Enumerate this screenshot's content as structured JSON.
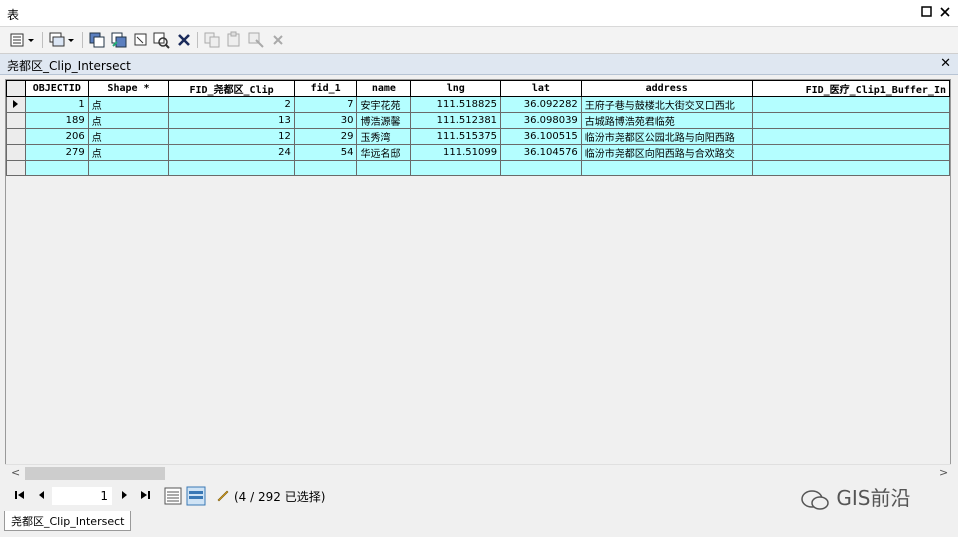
{
  "window": {
    "title": "表"
  },
  "tab": {
    "title": "尧都区_Clip_Intersect"
  },
  "table": {
    "columns": [
      "OBJECTID",
      "Shape *",
      "FID_尧都区_Clip",
      "fid_1",
      "name",
      "lng",
      "lat",
      "address",
      "FID_医疗_Clip1_Buffer_In"
    ],
    "rows": [
      [
        "1",
        "点",
        "2",
        "7",
        "安宇花苑",
        "111.518825",
        "36.092282",
        "王府子巷与鼓楼北大街交叉口西北",
        ""
      ],
      [
        "189",
        "点",
        "13",
        "30",
        "博浩源馨",
        "111.512381",
        "36.098039",
        "古城路博浩苑君临苑",
        ""
      ],
      [
        "206",
        "点",
        "12",
        "29",
        "玉秀湾",
        "111.515375",
        "36.100515",
        "临汾市尧都区公园北路与向阳西路",
        ""
      ],
      [
        "279",
        "点",
        "24",
        "54",
        "华远名邸",
        "111.51099",
        "36.104576",
        "临汾市尧都区向阳西路与合欢路交",
        ""
      ]
    ]
  },
  "status": {
    "page": "1",
    "selection": "(4 / 292 已选择)"
  },
  "bottom_tab": {
    "label": "尧都区_Clip_Intersect"
  },
  "watermark": {
    "text": "GIS前沿"
  },
  "colors": {
    "row_bg": "#b4feff",
    "tab_bg": "#dfe7f1"
  }
}
